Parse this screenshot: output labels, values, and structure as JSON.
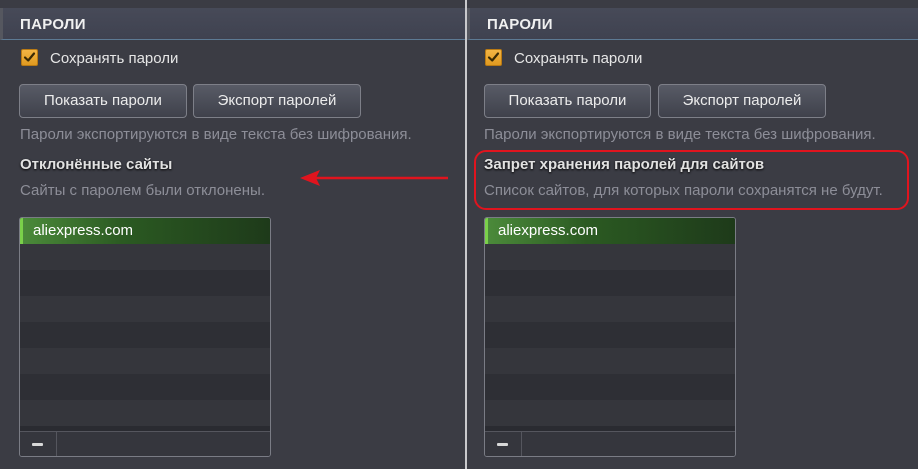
{
  "accent_color": "#f0ab30",
  "annotation_color": "#e0141e",
  "left_panel": {
    "section_title": "ПАРОЛИ",
    "save_passwords": {
      "label": "Сохранять пароли",
      "checked": true
    },
    "show_passwords_button": "Показать пароли",
    "export_passwords_button": "Экспорт паролей",
    "export_note": "Пароли экспортируются в виде текста без шифрования.",
    "subsection_title": "Отклонённые сайты",
    "subsection_desc": "Сайты с паролем были отклонены.",
    "sites": [
      "aliexpress.com"
    ]
  },
  "right_panel": {
    "section_title": "ПАРОЛИ",
    "save_passwords": {
      "label": "Сохранять пароли",
      "checked": true
    },
    "show_passwords_button": "Показать пароли",
    "export_passwords_button": "Экспорт паролей",
    "export_note": "Пароли экспортируются в виде текста без шифрования.",
    "subsection_title": "Запрет хранения паролей для сайтов",
    "subsection_desc": "Список сайтов, для которых пароли сохранятся не будут.",
    "sites": [
      "aliexpress.com"
    ]
  }
}
